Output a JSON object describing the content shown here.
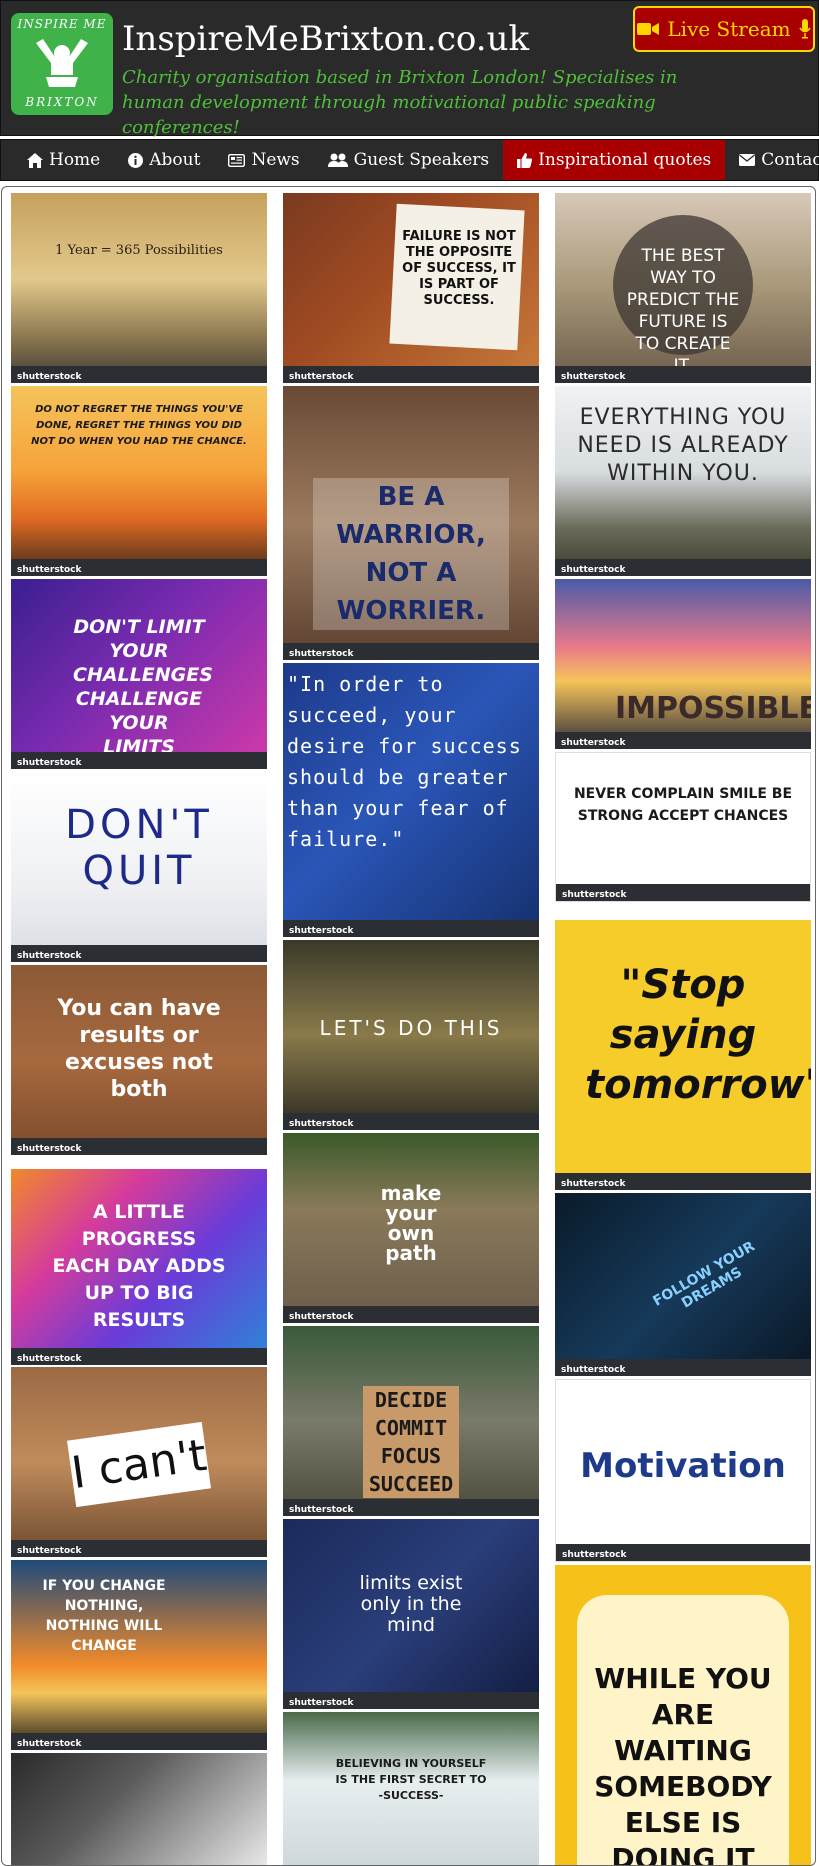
{
  "header": {
    "logo_lines": [
      "INSPIRE ME",
      "BRIXTON"
    ],
    "title": "InspireMeBrixton.co.uk",
    "tagline": "Charity organisation based in Brixton London! Specialises in human development through motivational public speaking conferences!",
    "live_stream_label": "Live Stream"
  },
  "nav": {
    "items": [
      {
        "label": "Home",
        "icon": "home-icon"
      },
      {
        "label": "About",
        "icon": "info-icon"
      },
      {
        "label": "News",
        "icon": "newspaper-icon"
      },
      {
        "label": "Guest Speakers",
        "icon": "users-icon"
      },
      {
        "label": "Inspirational quotes",
        "icon": "thumbs-up-icon",
        "active": true
      },
      {
        "label": "Contact",
        "icon": "envelope-icon"
      }
    ]
  },
  "gallery": {
    "watermark": "shutterstock",
    "tiles": [
      {
        "text": "1 Year = 365 Possibilities"
      },
      {
        "text": "DO NOT REGRET THE THINGS YOU'VE DONE, REGRET THE THINGS YOU DID NOT DO WHEN YOU HAD THE CHANCE."
      },
      {
        "text": "DON'T LIMIT YOUR CHALLENGES CHALLENGE YOUR LIMITS"
      },
      {
        "text": "DON'T QUIT"
      },
      {
        "text": "You can have results or excuses not both"
      },
      {
        "text": "A LITTLE PROGRESS EACH DAY ADDS UP TO BIG RESULTS"
      },
      {
        "text": "I can't"
      },
      {
        "text": "IF YOU CHANGE NOTHING, NOTHING WILL CHANGE"
      },
      {
        "text": ""
      },
      {
        "text": "FAILURE IS NOT THE OPPOSITE OF SUCCESS, IT IS PART OF SUCCESS."
      },
      {
        "text": "BE A WARRIOR, NOT A WORRIER."
      },
      {
        "text": "\"In order to succeed, your desire for success should be greater than your fear of failure.\""
      },
      {
        "text": "LET'S DO THIS"
      },
      {
        "text": "make your own path"
      },
      {
        "text": "DECIDE COMMIT FOCUS SUCCEED"
      },
      {
        "text": "limits exist only in the mind"
      },
      {
        "text": "BELIEVING IN YOURSELF IS THE FIRST SECRET TO -SUCCESS-"
      },
      {
        "text": "THE BEST WAY TO PREDICT THE FUTURE IS TO CREATE IT."
      },
      {
        "text": "EVERYTHING YOU NEED IS ALREADY WITHIN YOU."
      },
      {
        "text": "IMPOSSIBLE"
      },
      {
        "text": "NEVER COMPLAIN SMILE BE STRONG ACCEPT CHANCES"
      },
      {
        "text": "\"Stop saying tomorrow\""
      },
      {
        "text": "FOLLOW YOUR DREAMS"
      },
      {
        "text": "Motivation"
      },
      {
        "text": "WHILE YOU ARE WAITING SOMEBODY ELSE IS DOING IT"
      }
    ]
  }
}
